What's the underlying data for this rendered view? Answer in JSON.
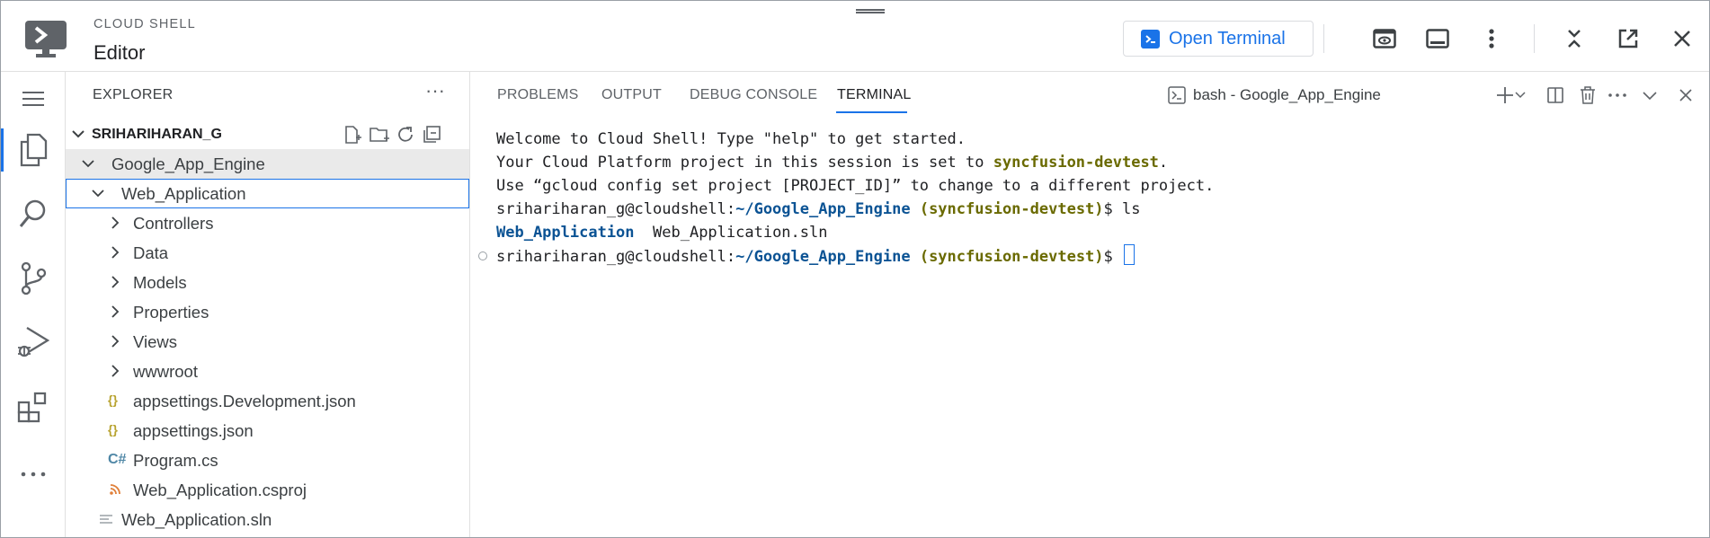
{
  "header": {
    "brand_top": "CLOUD SHELL",
    "brand_title": "Editor",
    "open_terminal_label": "Open Terminal",
    "accent_color": "#1a73e8"
  },
  "explorer": {
    "title": "EXPLORER",
    "root_label": "SRIHARIHARAN_G",
    "items": [
      {
        "label": "Google_App_Engine",
        "type": "folder",
        "expanded": true
      },
      {
        "label": "Web_Application",
        "type": "folder",
        "expanded": true
      },
      {
        "label": "Controllers",
        "type": "folder",
        "expanded": false
      },
      {
        "label": "Data",
        "type": "folder",
        "expanded": false
      },
      {
        "label": "Models",
        "type": "folder",
        "expanded": false
      },
      {
        "label": "Properties",
        "type": "folder",
        "expanded": false
      },
      {
        "label": "Views",
        "type": "folder",
        "expanded": false
      },
      {
        "label": "wwwroot",
        "type": "folder",
        "expanded": false
      },
      {
        "label": "appsettings.Development.json",
        "type": "json-file"
      },
      {
        "label": "appsettings.json",
        "type": "json-file"
      },
      {
        "label": "Program.cs",
        "type": "csharp-file"
      },
      {
        "label": "Web_Application.csproj",
        "type": "rss-file"
      },
      {
        "label": "Web_Application.sln",
        "type": "text-file"
      }
    ]
  },
  "panel": {
    "tabs": [
      "PROBLEMS",
      "OUTPUT",
      "DEBUG CONSOLE",
      "TERMINAL"
    ],
    "active_tab": "TERMINAL",
    "terminal_name": "bash - Google_App_Engine"
  },
  "terminal": {
    "line1": "Welcome to Cloud Shell! Type \"help\" to get started.",
    "line2_pre": "Your Cloud Platform project in this session is set to ",
    "project": "syncfusion-devtest",
    "line2_post": ".",
    "line3": "Use “gcloud config set project [PROJECT_ID]” to change to a different project.",
    "user_host": "srihariharan_g@cloudshell:",
    "path": "~/Google_App_Engine",
    "project_paren": "(syncfusion-devtest)",
    "prompt_end": "$ ",
    "command": "ls",
    "ls_dir": "Web_Application",
    "ls_file": "Web_Application.sln"
  }
}
